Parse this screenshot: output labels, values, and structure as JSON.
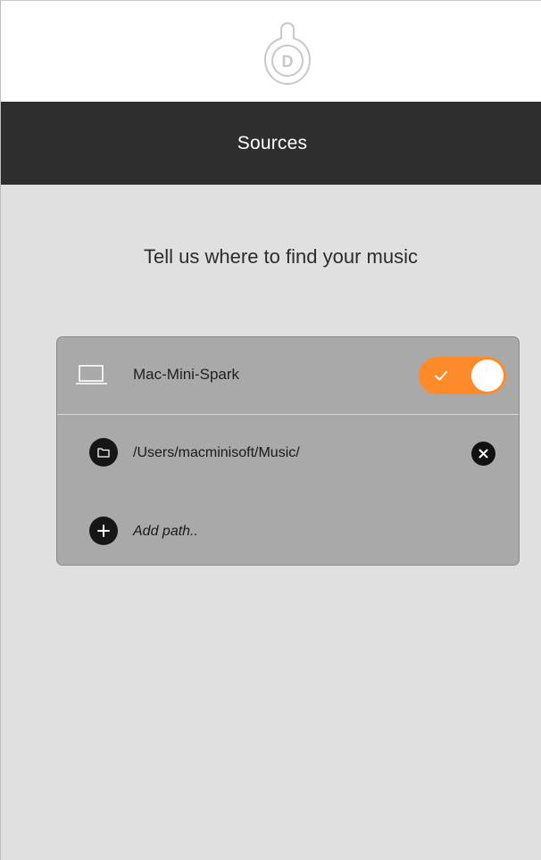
{
  "header": {
    "logo_letter": "D",
    "title": "Sources"
  },
  "main": {
    "heading": "Tell us where to find your music"
  },
  "source": {
    "device_name": "Mac-Mini-Spark",
    "enabled": true,
    "paths": [
      {
        "path": "/Users/macminisoft/Music/"
      }
    ],
    "add_path_label": "Add path.."
  },
  "colors": {
    "accent": "#ff8a2a",
    "title_bar": "#2e2e2e",
    "background": "#e0e0e0",
    "card": "#a9a9a9"
  }
}
